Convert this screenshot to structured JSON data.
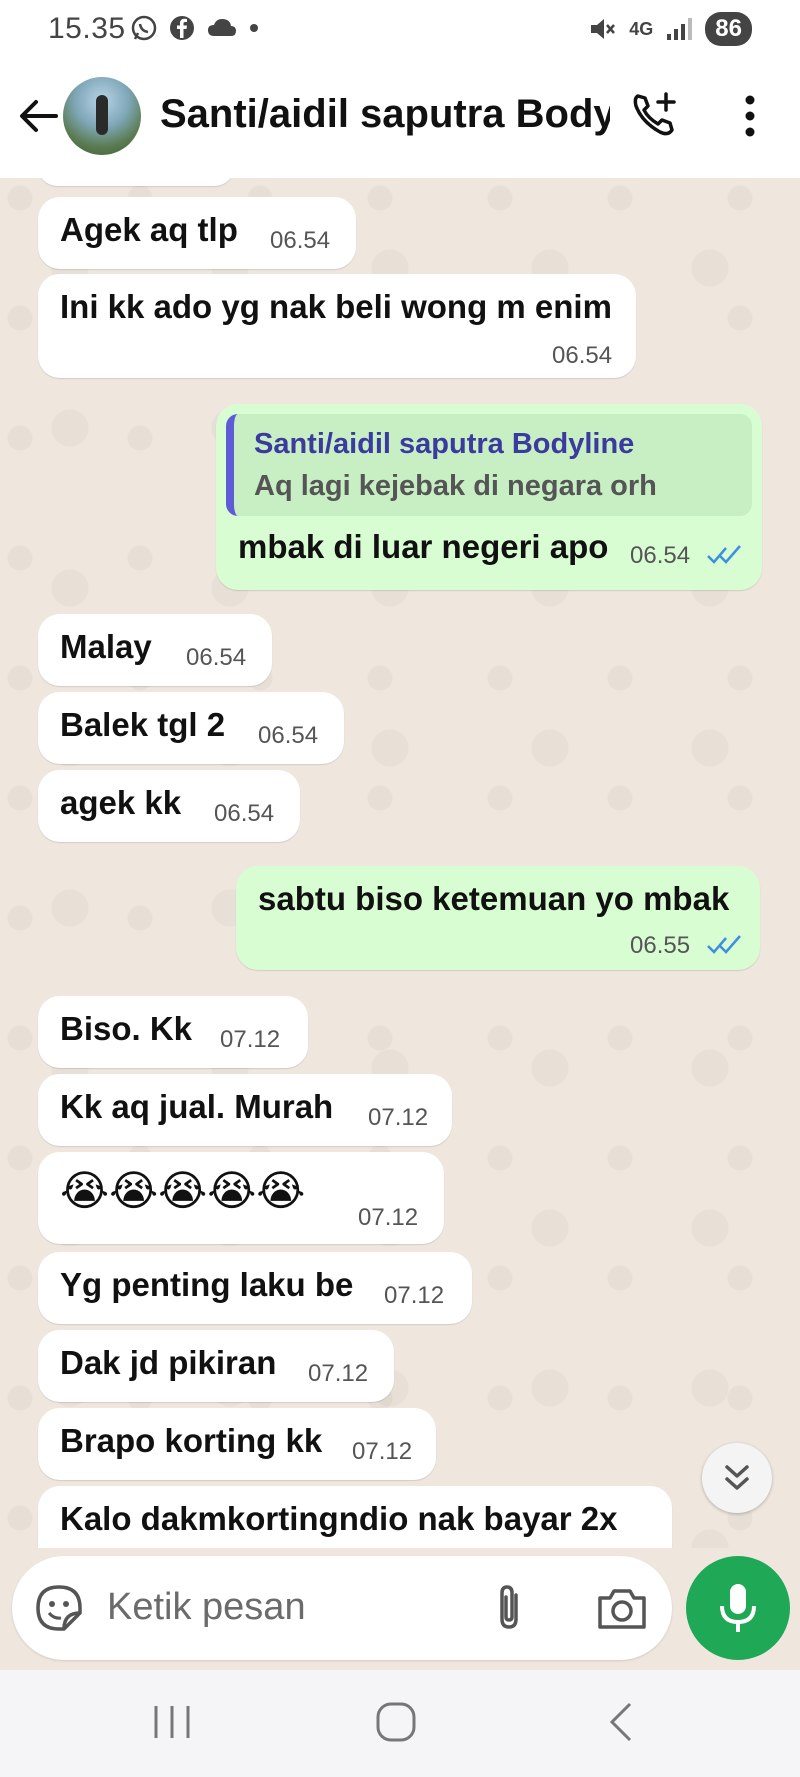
{
  "status_bar": {
    "time": "15.35",
    "network": "4G",
    "battery": "86"
  },
  "header": {
    "title": "Santi/aidil saputra Bodyl..."
  },
  "messages": [
    {
      "dir": "in",
      "text": "Agek aq tlp",
      "time": "06.54"
    },
    {
      "dir": "in",
      "text": "Ini kk ado yg nak beli wong m enim",
      "time": "06.54"
    },
    {
      "dir": "out",
      "quote_name": "Santi/aidil saputra Bodyline",
      "quote_text": "Aq lagi kejebak di negara orh",
      "text": "mbak di luar negeri apo",
      "time": "06.54"
    },
    {
      "dir": "in",
      "text": "Malay",
      "time": "06.54"
    },
    {
      "dir": "in",
      "text": "Balek tgl 2",
      "time": "06.54"
    },
    {
      "dir": "in",
      "text": "agek kk",
      "time": "06.54"
    },
    {
      "dir": "out",
      "text": "sabtu biso ketemuan yo mbak",
      "time": "06.55"
    },
    {
      "dir": "in",
      "text": "Biso. Kk",
      "time": "07.12"
    },
    {
      "dir": "in",
      "text": "Kk aq jual. Murah",
      "time": "07.12"
    },
    {
      "dir": "in",
      "text": "😭😭😭😭😭",
      "time": "07.12"
    },
    {
      "dir": "in",
      "text": "Yg penting laku be",
      "time": "07.12"
    },
    {
      "dir": "in",
      "text": "Dak jd pikiran",
      "time": "07.12"
    },
    {
      "dir": "in",
      "text": "Brapo korting kk",
      "time": "07.12"
    },
    {
      "dir": "in",
      "text": "Kalo dakmkortingndio nak bayar 2x",
      "time": ""
    }
  ],
  "input": {
    "placeholder": "Ketik pesan"
  },
  "colors": {
    "outgoing_bubble": "#d9fdd3",
    "incoming_bubble": "#ffffff",
    "accent_green": "#1fa855",
    "read_ticks": "#3d8fe0",
    "quote_bar": "#5f5ad6"
  },
  "icons": [
    "whatsapp-icon",
    "facebook-icon",
    "cloud-icon",
    "mute-icon",
    "signal-icon",
    "back-arrow-icon",
    "add-call-icon",
    "more-vert-icon",
    "sticker-icon",
    "attach-icon",
    "camera-icon",
    "mic-icon",
    "chevron-double-down-icon",
    "recents-icon",
    "home-icon",
    "nav-back-icon"
  ]
}
